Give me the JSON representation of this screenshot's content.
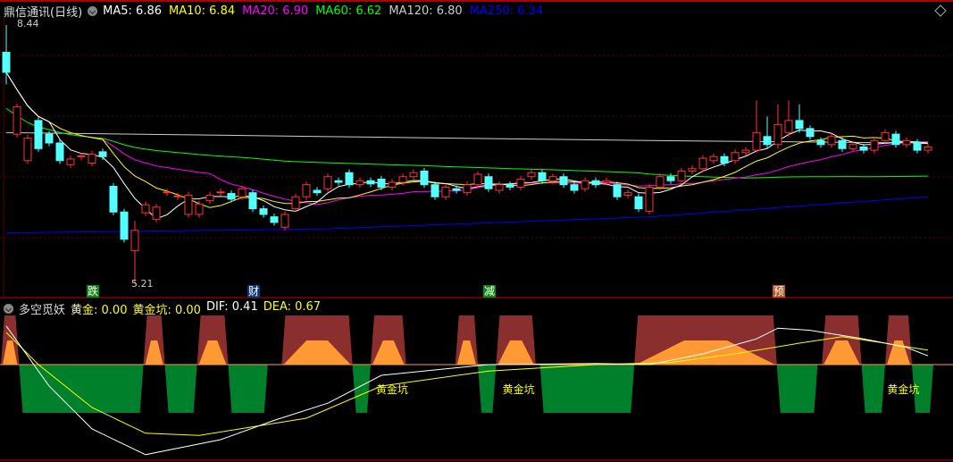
{
  "header": {
    "title": "鼎信通讯(日线)",
    "ma": [
      {
        "label": "MA5: 6.86",
        "color": "#ffffff"
      },
      {
        "label": "MA10: 6.84",
        "color": "#ffff00"
      },
      {
        "label": "MA20: 6.90",
        "color": "#ff00ff"
      },
      {
        "label": "MA60: 6.62",
        "color": "#00ff00"
      },
      {
        "label": "MA120: 6.80",
        "color": "#cccccc"
      },
      {
        "label": "MA250: 6.34",
        "color": "#0000ff"
      }
    ]
  },
  "price_marks": {
    "high": "8.44",
    "low": "5.21"
  },
  "event_tags": [
    {
      "text": "跌",
      "color": "#0a8a0a",
      "index": 8
    },
    {
      "text": "财",
      "color": "#0a3a7a",
      "index": 23
    },
    {
      "text": "减",
      "color": "#0a8a0a",
      "index": 45
    },
    {
      "text": "预",
      "color": "#c0501a",
      "index": 72
    }
  ],
  "indicator": {
    "name": "多空觅妖",
    "values": [
      {
        "label": "黄金: 0.00",
        "color": "#ffff00"
      },
      {
        "label": "黄金坑: 0.00",
        "color": "#ffff00"
      },
      {
        "label": "DIF: 0.41",
        "color": "#ffffff"
      },
      {
        "label": "DEA: 0.67",
        "color": "#ffff00"
      }
    ],
    "pit_label": "黄金坑",
    "pit_positions": [
      36,
      47.8,
      83.7
    ],
    "green_zones": [
      [
        1.2,
        12.8
      ],
      [
        14.8,
        17.8
      ],
      [
        20.7,
        24.4
      ],
      [
        32.3,
        34
      ],
      [
        44,
        45.7
      ],
      [
        49.8,
        58.6
      ],
      [
        71.9,
        75.7
      ],
      [
        79.8,
        82
      ],
      [
        84.5,
        86.5
      ]
    ],
    "red_zones": [
      [
        -0.5,
        1.2
      ],
      [
        12.8,
        14.8
      ],
      [
        17.8,
        20.7
      ],
      [
        25.7,
        32.3
      ],
      [
        34,
        37.3
      ],
      [
        41.9,
        44
      ],
      [
        45.7,
        49.4
      ],
      [
        58.6,
        71.9
      ],
      [
        76.1,
        79.8
      ],
      [
        82,
        84.5
      ]
    ],
    "dif": [
      [
        0,
        1.8
      ],
      [
        4,
        -1
      ],
      [
        8,
        -3
      ],
      [
        13,
        -4.2
      ],
      [
        20,
        -3.5
      ],
      [
        25,
        -2.6
      ],
      [
        30,
        -1.8
      ],
      [
        35,
        -0.5
      ],
      [
        45,
        0
      ],
      [
        55,
        0.05
      ],
      [
        60,
        0
      ],
      [
        65,
        0.5
      ],
      [
        70,
        1.2
      ],
      [
        72,
        1.7
      ],
      [
        75,
        1.6
      ],
      [
        80,
        1.2
      ],
      [
        84,
        0.8
      ],
      [
        86,
        0.41
      ]
    ],
    "dea": [
      [
        0,
        1.5
      ],
      [
        3,
        0
      ],
      [
        8,
        -2
      ],
      [
        13,
        -3.2
      ],
      [
        18,
        -3.3
      ],
      [
        28,
        -2.5
      ],
      [
        35,
        -1
      ],
      [
        45,
        -0.3
      ],
      [
        55,
        0
      ],
      [
        62,
        0.1
      ],
      [
        68,
        0.5
      ],
      [
        74,
        1
      ],
      [
        78,
        1.3
      ],
      [
        82,
        1.0
      ],
      [
        86,
        0.67
      ]
    ]
  },
  "candles": [
    [
      8.1,
      7.85
    ],
    [
      7.08,
      7.42
    ],
    [
      6.75,
      7.03
    ],
    [
      7.25,
      6.9
    ],
    [
      7.08,
      6.97
    ],
    [
      6.97,
      6.75
    ],
    [
      6.7,
      6.77
    ],
    [
      6.8,
      6.81
    ],
    [
      6.72,
      6.83
    ],
    [
      6.86,
      6.8
    ],
    [
      6.43,
      6.11
    ],
    [
      6.11,
      5.77
    ],
    [
      5.63,
      5.88
    ],
    [
      6.1,
      6.2
    ],
    [
      6.02,
      6.17
    ],
    [
      6.35,
      6.36
    ],
    [
      6.3,
      6.31
    ],
    [
      6.08,
      6.32
    ],
    [
      6.08,
      6.21
    ],
    [
      6.25,
      6.32
    ],
    [
      6.35,
      6.36
    ],
    [
      6.34,
      6.27
    ],
    [
      6.3,
      6.4
    ],
    [
      6.35,
      6.15
    ],
    [
      6.15,
      6.08
    ],
    [
      6.05,
      5.98
    ],
    [
      5.92,
      6.08
    ],
    [
      6.15,
      6.3
    ],
    [
      6.3,
      6.45
    ],
    [
      6.38,
      6.35
    ],
    [
      6.4,
      6.55
    ],
    [
      6.5,
      6.48
    ],
    [
      6.6,
      6.45
    ],
    [
      6.45,
      6.5
    ],
    [
      6.5,
      6.46
    ],
    [
      6.52,
      6.42
    ],
    [
      6.42,
      6.48
    ],
    [
      6.48,
      6.55
    ],
    [
      6.55,
      6.6
    ],
    [
      6.62,
      6.45
    ],
    [
      6.45,
      6.3
    ],
    [
      6.3,
      6.42
    ],
    [
      6.4,
      6.38
    ],
    [
      6.35,
      6.45
    ],
    [
      6.45,
      6.58
    ],
    [
      6.55,
      6.4
    ],
    [
      6.38,
      6.45
    ],
    [
      6.45,
      6.42
    ],
    [
      6.42,
      6.52
    ],
    [
      6.55,
      6.6
    ],
    [
      6.6,
      6.5
    ],
    [
      6.5,
      6.55
    ],
    [
      6.55,
      6.45
    ],
    [
      6.45,
      6.38
    ],
    [
      6.4,
      6.5
    ],
    [
      6.5,
      6.45
    ],
    [
      6.48,
      6.5
    ],
    [
      6.45,
      6.3
    ],
    [
      6.32,
      6.35
    ],
    [
      6.3,
      6.15
    ],
    [
      6.12,
      6.42
    ],
    [
      6.42,
      6.55
    ],
    [
      6.55,
      6.5
    ],
    [
      6.5,
      6.62
    ],
    [
      6.62,
      6.65
    ],
    [
      6.65,
      6.78
    ],
    [
      6.75,
      6.8
    ],
    [
      6.8,
      6.72
    ],
    [
      6.75,
      6.85
    ],
    [
      6.85,
      6.88
    ],
    [
      6.88,
      7.1
    ],
    [
      7.05,
      6.95
    ],
    [
      6.95,
      7.2
    ],
    [
      7.1,
      7.25
    ],
    [
      7.25,
      7.15
    ],
    [
      7.15,
      7.05
    ],
    [
      7.0,
      6.95
    ],
    [
      6.95,
      7.05
    ],
    [
      7.0,
      6.9
    ],
    [
      6.9,
      6.95
    ],
    [
      6.92,
      6.88
    ],
    [
      6.88,
      7.0
    ],
    [
      7.0,
      7.1
    ],
    [
      7.08,
      6.95
    ],
    [
      6.95,
      7.0
    ],
    [
      6.98,
      6.88
    ],
    [
      6.88,
      6.92
    ]
  ],
  "wick_overrides": {
    "0": [
      8.44,
      7.7
    ],
    "12": [
      6.0,
      5.21
    ],
    "70": [
      7.5,
      6.85
    ],
    "71": [
      7.3,
      6.9
    ],
    "72": [
      7.45,
      6.9
    ],
    "73": [
      7.5,
      7.05
    ],
    "74": [
      7.45,
      7.1
    ]
  },
  "ma120": [
    [
      0,
      7.1
    ],
    [
      30,
      7.05
    ],
    [
      60,
      7.0
    ],
    [
      86,
      6.97
    ]
  ],
  "ma250": [
    [
      0,
      5.85
    ],
    [
      30,
      5.9
    ],
    [
      60,
      6.05
    ],
    [
      86,
      6.3
    ]
  ],
  "colors": {
    "up": "#ff3232",
    "down": "#54ffff",
    "bear_zone": "#00802a",
    "bull_zone": "#8b2e2e",
    "peak": "#ff9933"
  }
}
